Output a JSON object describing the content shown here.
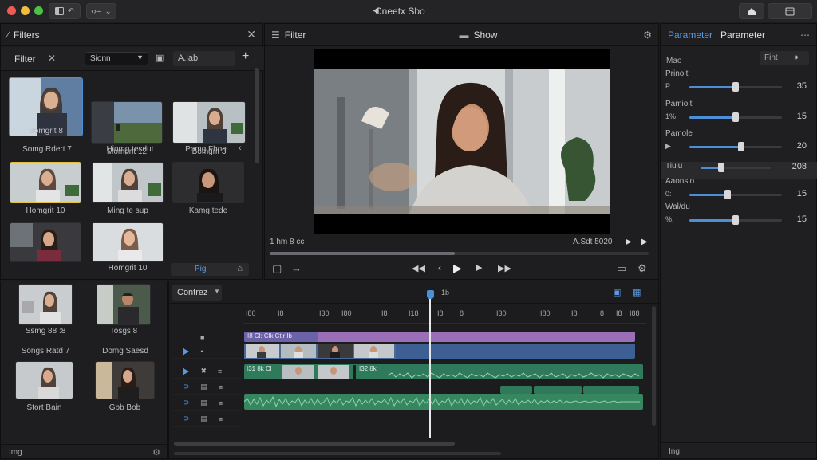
{
  "window": {
    "title": "Cneetx Sbo"
  },
  "toolbar": {
    "view_label": "‹›–"
  },
  "filters_panel": {
    "title": "Filters",
    "filter_label": "Filter",
    "dropdown_value": "Sionn",
    "search_value": "A.lab",
    "thumbs": [
      {
        "label": "Bomgrit 8"
      },
      {
        "label": "Momgrit 12"
      },
      {
        "label": "Bomgrit 3"
      },
      {
        "label": "Homgrit 10"
      },
      {
        "label": "Ming te sup"
      },
      {
        "label": "Kamg tede"
      },
      {
        "label": ""
      },
      {
        "label": "Homgrit 10"
      }
    ],
    "row_captions": [
      "Somg Rdert 7",
      "Hiomg tesdut",
      "Pomg Fhne"
    ],
    "apply_button": "Pig"
  },
  "media_panel": {
    "items": [
      {
        "label": "Ssmg 88 :8"
      },
      {
        "label": "Tosgs 8"
      },
      {
        "label": ""
      },
      {
        "label": ""
      }
    ],
    "captions": [
      "Songs Ratd 7",
      "Domg Saesd",
      "Stort Bain",
      "Gbb Bob"
    ],
    "footer_label": "Img"
  },
  "viewer": {
    "filter_label": "Filter",
    "show_label": "Show",
    "timecode_left": "1 hm 8 cc",
    "timecode_right": "A.Sdt 5020"
  },
  "params": {
    "tab_active": "Parameter",
    "tab_other": "Parameter",
    "section_label": "Mao",
    "find_button": "Fint",
    "rows": [
      {
        "label": "Prinolt",
        "prefix": "P:",
        "value": "35",
        "level": 0.5
      },
      {
        "label": "Pamiolt",
        "prefix": "1%",
        "value": "15",
        "level": 0.5
      },
      {
        "label": "Pamole",
        "prefix": "▶",
        "value": "20",
        "level": 0.56
      },
      {
        "label": "Tiulu",
        "prefix": "",
        "value": "208",
        "level": 0.3
      },
      {
        "label": "Aaonslo",
        "prefix": "0:",
        "value": "15",
        "level": 0.41
      },
      {
        "label": "Wal/du",
        "prefix": "%:",
        "value": "15",
        "level": 0.5
      }
    ],
    "footer_label": "Ing"
  },
  "timeline": {
    "sequence_label": "Contrez",
    "playhead_label": "1b",
    "ruler": [
      "I80",
      "I8",
      "I30",
      "I80",
      "I8",
      "I18",
      "I8",
      "8",
      "I30",
      "I80",
      "I8",
      "8",
      "I8",
      "I88"
    ],
    "clip_labels": {
      "v1": "I8 Cl: Clk Ctir Ib",
      "v2": "I31 8k Cl",
      "v3": "I32 8k"
    }
  },
  "colors": {
    "accent": "#4d8fd6",
    "purple_track": "#9a6fb8",
    "blue_track": "#3d5f93",
    "green_track": "#2f7a5a"
  }
}
